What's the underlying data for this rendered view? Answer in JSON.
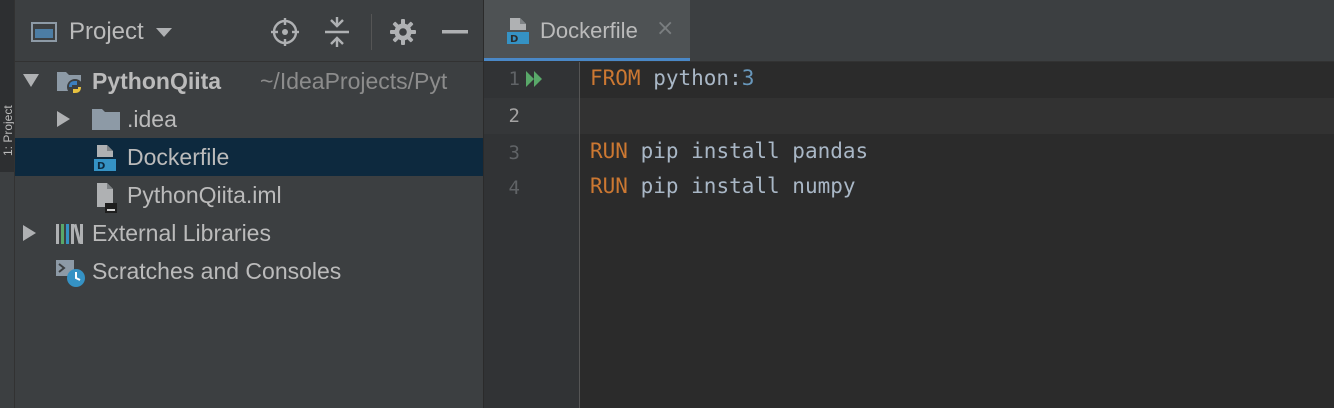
{
  "stripe": {
    "tab_label": "1: Project"
  },
  "project_panel": {
    "title": "Project",
    "header_icons": [
      "locate-icon",
      "collapse-all-icon",
      "gear-icon",
      "hide-icon"
    ],
    "tree": [
      {
        "label": "PythonQiita",
        "path": "~/IdeaProjects/Pyt",
        "type": "module",
        "expanded": true
      },
      {
        "label": ".idea",
        "type": "folder",
        "expanded": false
      },
      {
        "label": "Dockerfile",
        "type": "dockerfile",
        "selected": true
      },
      {
        "label": "PythonQiita.iml",
        "type": "iml-file"
      },
      {
        "label": "External Libraries",
        "type": "libraries",
        "expanded": false
      },
      {
        "label": "Scratches and Consoles",
        "type": "scratches"
      }
    ]
  },
  "editor": {
    "tab": {
      "label": "Dockerfile",
      "close": "×"
    },
    "line_numbers": [
      "1",
      "2",
      "3",
      "4"
    ],
    "lines": [
      {
        "keyword": "FROM",
        "rest": " python:",
        "number": "3"
      },
      {
        "keyword": "",
        "rest": "",
        "number": ""
      },
      {
        "keyword": "RUN",
        "rest": " pip install pandas",
        "number": ""
      },
      {
        "keyword": "RUN",
        "rest": " pip install numpy",
        "number": ""
      }
    ]
  },
  "colors": {
    "keyword": "#cc7832",
    "number": "#6897bb",
    "selection": "#0d293e",
    "run_icon": "#59a869"
  }
}
